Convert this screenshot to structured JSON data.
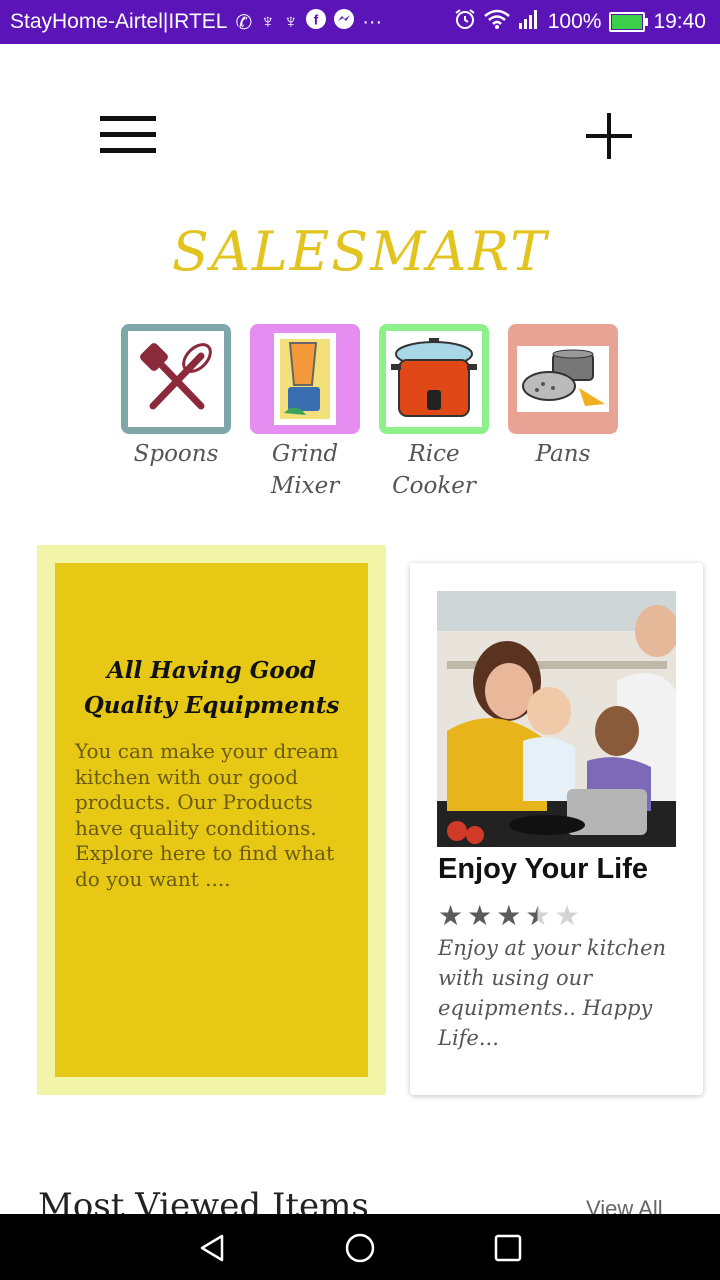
{
  "status_bar": {
    "carrier": "StayHome-Airtel|IRTEL",
    "notification_icons": [
      "phone-icon",
      "usb-icon",
      "usb-icon",
      "facebook-icon",
      "messenger-icon",
      "more-icon"
    ],
    "right_icons": [
      "alarm-icon",
      "wifi-icon",
      "signal-icon"
    ],
    "battery": "100%",
    "battery_level": 1.0,
    "time": "19:40",
    "bg_color": "#5b14b8"
  },
  "header": {
    "menu_icon": "hamburger-menu-icon",
    "add_icon": "plus-icon",
    "brand": "SALESMART",
    "brand_color": "#e3c41e"
  },
  "categories": [
    {
      "label_line1": "Spoons",
      "label_line2": "",
      "border_color": "#7fa6a8",
      "icon": "spoons-icon"
    },
    {
      "label_line1": "Grind",
      "label_line2": "Mixer",
      "border_color": "#e58cf0",
      "icon": "grind-mixer-icon"
    },
    {
      "label_line1": "Rice",
      "label_line2": "Cooker",
      "border_color": "#8ef08a",
      "icon": "rice-cooker-icon"
    },
    {
      "label_line1": "Pans",
      "label_line2": "",
      "border_color": "#e9a394",
      "icon": "pans-icon"
    }
  ],
  "promo": {
    "title": "All Having Good Quality Equipments",
    "body": "You can make your dream kitchen with our good products. Our Products have quality conditions. Explore here to find what do you want ...."
  },
  "life_card": {
    "title": "Enjoy Your Life",
    "rating": 3.5,
    "rating_max": 5,
    "text": "Enjoy at your kitchen with using our equipments.. Happy Life..."
  },
  "most_viewed": {
    "title": "Most Viewed Items",
    "link": "View All"
  },
  "nav": {
    "back": "back-icon",
    "home": "home-icon",
    "recents": "recents-icon"
  }
}
